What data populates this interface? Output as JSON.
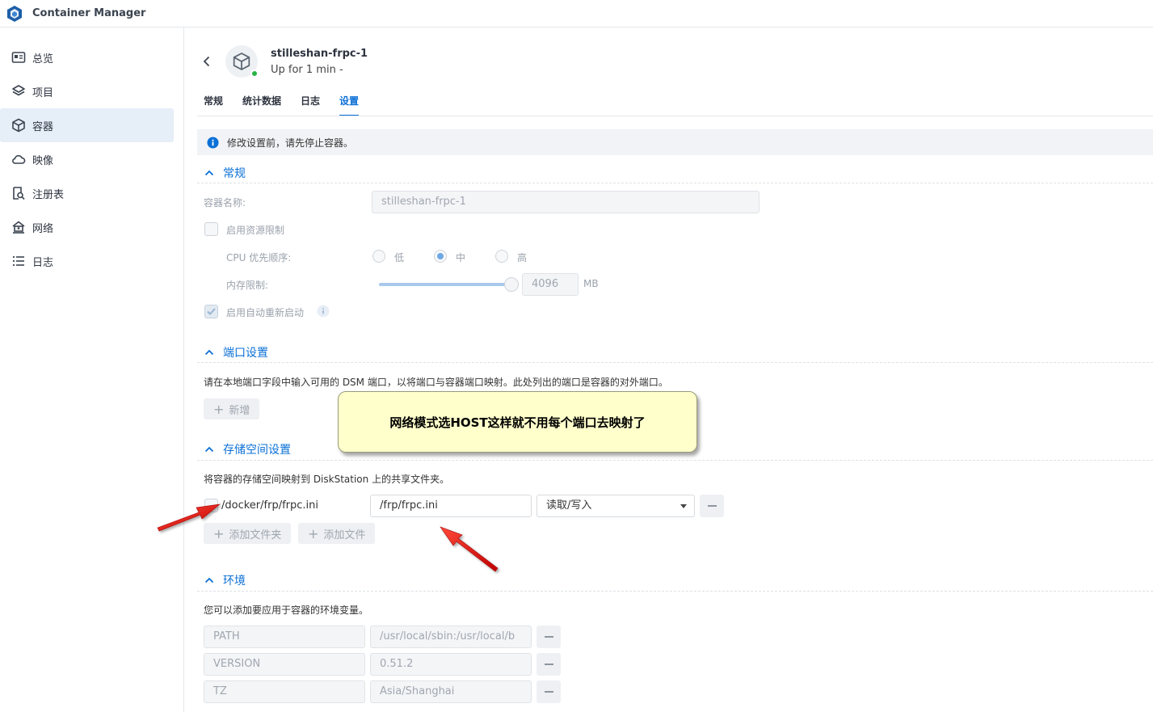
{
  "app": {
    "title": "Container Manager"
  },
  "sidebar": {
    "items": [
      {
        "label": "总览",
        "icon": "overview-icon"
      },
      {
        "label": "项目",
        "icon": "layers-icon"
      },
      {
        "label": "容器",
        "icon": "container-icon",
        "active": true
      },
      {
        "label": "映像",
        "icon": "cloud-icon"
      },
      {
        "label": "注册表",
        "icon": "registry-search-icon"
      },
      {
        "label": "网络",
        "icon": "network-house-icon"
      },
      {
        "label": "日志",
        "icon": "list-icon"
      }
    ]
  },
  "container": {
    "name": "stilleshan-frpc-1",
    "status": "Up for 1 min -"
  },
  "tabs": [
    {
      "label": "常规"
    },
    {
      "label": "统计数据"
    },
    {
      "label": "日志"
    },
    {
      "label": "设置",
      "active": true
    }
  ],
  "notice": "修改设置前，请先停止容器。",
  "general": {
    "title": "常规",
    "name_label": "容器名称:",
    "name_value": "stilleshan-frpc-1",
    "resource_limit_label": "启用资源限制",
    "cpu_label": "CPU 优先顺序:",
    "cpu_options": [
      "低",
      "中",
      "高"
    ],
    "cpu_selected": "中",
    "memory_label": "内存限制:",
    "memory_value": "4096",
    "memory_unit": "MB",
    "memory_fraction": 1.0,
    "auto_restart_label": "启用自动重新启动"
  },
  "ports": {
    "title": "端口设置",
    "description": "请在本地端口字段中输入可用的 DSM 端口，以将端口与容器端口映射。此处列出的端口是容器的对外端口。",
    "add_label": "新增"
  },
  "storage": {
    "title": "存储空间设置",
    "description": "将容器的存储空间映射到 DiskStation 上的共享文件夹。",
    "host_path": "/docker/frp/frpc.ini",
    "container_path": "/frp/frpc.ini",
    "mode": "读取/写入",
    "add_folder_label": "添加文件夹",
    "add_file_label": "添加文件"
  },
  "environment": {
    "title": "环境",
    "description": "您可以添加要应用于容器的环境变量。",
    "vars": [
      {
        "key": "PATH",
        "value": "/usr/local/sbin:/usr/local/b"
      },
      {
        "key": "VERSION",
        "value": "0.51.2"
      },
      {
        "key": "TZ",
        "value": "Asia/Shanghai"
      }
    ]
  },
  "annotation": {
    "text": "网络模式选HOST这样就不用每个端口去映射了"
  },
  "colors": {
    "accent": "#0b70d6",
    "running": "#27b446",
    "arrow": "#e01010",
    "callout_bg": "#ffffcc"
  }
}
